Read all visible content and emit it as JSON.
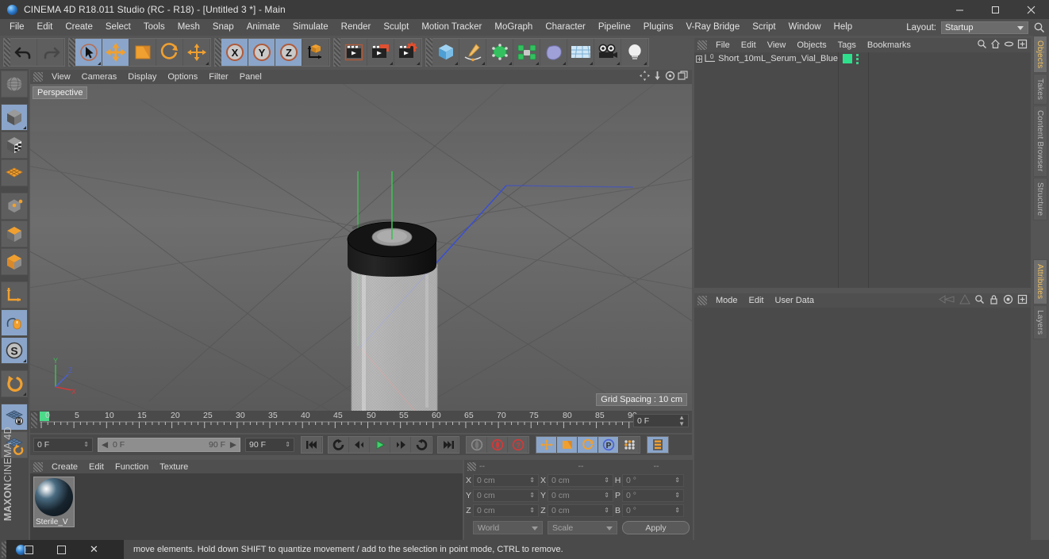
{
  "titlebar": {
    "title": "CINEMA 4D R18.011 Studio (RC - R18) - [Untitled 3 *] - Main",
    "minimize": "minimize-icon",
    "maximize": "maximize-icon",
    "close": "close-icon"
  },
  "menubar": {
    "items": [
      {
        "label": "File"
      },
      {
        "label": "Edit"
      },
      {
        "label": "Create"
      },
      {
        "label": "Select"
      },
      {
        "label": "Tools"
      },
      {
        "label": "Mesh"
      },
      {
        "label": "Snap"
      },
      {
        "label": "Animate"
      },
      {
        "label": "Simulate"
      },
      {
        "label": "Render"
      },
      {
        "label": "Sculpt"
      },
      {
        "label": "Motion Tracker"
      },
      {
        "label": "MoGraph"
      },
      {
        "label": "Character"
      },
      {
        "label": "Pipeline"
      },
      {
        "label": "Plugins"
      },
      {
        "label": "V-Ray Bridge"
      },
      {
        "label": "Script"
      },
      {
        "label": "Window"
      },
      {
        "label": "Help"
      }
    ],
    "layout_label": "Layout:",
    "layout_value": "Startup"
  },
  "toolbar": {
    "groups": [
      {
        "buttons": [
          {
            "name": "undo-button",
            "active": false
          },
          {
            "name": "redo-button",
            "active": false
          }
        ]
      },
      {
        "buttons": [
          {
            "name": "live-selection-tool",
            "active": true
          },
          {
            "name": "move-tool",
            "active": true
          },
          {
            "name": "scale-tool",
            "active": false
          },
          {
            "name": "rotate-tool",
            "active": false
          },
          {
            "name": "move-secondary-tool",
            "active": false
          }
        ]
      },
      {
        "buttons": [
          {
            "name": "x-axis-lock",
            "active": true
          },
          {
            "name": "y-axis-lock",
            "active": true
          },
          {
            "name": "z-axis-lock",
            "active": true
          },
          {
            "name": "world-object-coordinate-toggle",
            "active": false
          }
        ]
      },
      {
        "buttons": [
          {
            "name": "render-view-button",
            "active": false
          },
          {
            "name": "render-region-button",
            "active": false
          },
          {
            "name": "render-settings-button",
            "active": false
          }
        ]
      },
      {
        "buttons": [
          {
            "name": "add-cube-object",
            "active": false
          },
          {
            "name": "add-spline-object",
            "active": false
          },
          {
            "name": "add-generator-object",
            "active": false
          },
          {
            "name": "add-mograph-object",
            "active": false
          },
          {
            "name": "add-deformer-object",
            "active": false
          },
          {
            "name": "add-scene-object",
            "active": false
          },
          {
            "name": "add-camera-object",
            "active": false
          },
          {
            "name": "add-light-object",
            "active": false
          }
        ]
      }
    ]
  },
  "left_toolbar": {
    "buttons": [
      {
        "name": "make-editable-button",
        "active": false
      },
      {
        "name": "model-mode-button",
        "active": true
      },
      {
        "name": "texture-mode-button",
        "active": false
      },
      {
        "name": "polygon-mode-button",
        "active": false
      },
      {
        "name": "point-mode-button",
        "active": false
      },
      {
        "name": "edge-mode-button",
        "active": false
      },
      {
        "name": "face-mode-button",
        "active": false
      },
      {
        "name": "axis-mode-button",
        "active": false
      },
      {
        "name": "enable-axis-modification",
        "active": true
      },
      {
        "name": "soft-selection-button",
        "active": true
      },
      {
        "name": "undo-view-button",
        "active": false
      },
      {
        "name": "lock-workplane-button",
        "active": true
      },
      {
        "name": "workplane-toggle-button",
        "active": false
      }
    ],
    "brand_maxon": "MAXON",
    "brand_product": "CINEMA 4D"
  },
  "viewport": {
    "menus": [
      "View",
      "Cameras",
      "Display",
      "Options",
      "Filter",
      "Panel"
    ],
    "camera_tag": "Perspective",
    "grid_spacing": "Grid Spacing : 10 cm",
    "axis_labels": {
      "x": "X",
      "y": "Y",
      "z": "Z"
    },
    "corner_icons": [
      "pan-view-icon",
      "dolly-view-icon",
      "rotate-view-icon",
      "maximize-view-icon"
    ]
  },
  "timeline": {
    "ticks": [
      "0",
      "5",
      "10",
      "15",
      "20",
      "25",
      "30",
      "35",
      "40",
      "45",
      "50",
      "55",
      "60",
      "65",
      "70",
      "75",
      "80",
      "85",
      "90"
    ],
    "current_frame_field": "0 F"
  },
  "transport": {
    "start_frame": "0 F",
    "range_start": "0 F",
    "range_end": "90 F",
    "end_frame": "90 F",
    "buttons": [
      {
        "name": "goto-start-button",
        "active": false
      },
      {
        "name": "play-forwards-loop-button",
        "active": false
      },
      {
        "name": "step-back-button",
        "active": false
      },
      {
        "name": "play-button",
        "active": false
      },
      {
        "name": "step-forward-button",
        "active": false
      },
      {
        "name": "loop-button",
        "active": false
      },
      {
        "name": "goto-end-button",
        "active": false
      },
      {
        "name": "record-active-objects-button",
        "active": false
      },
      {
        "name": "autokeying-button",
        "active": false
      },
      {
        "name": "keyframe-selection-button",
        "active": false
      },
      {
        "name": "position-key-button",
        "active": true
      },
      {
        "name": "scale-key-button",
        "active": true
      },
      {
        "name": "rotation-key-button",
        "active": true
      },
      {
        "name": "parameter-key-button",
        "active": true
      },
      {
        "name": "point-level-animation-button",
        "active": false
      },
      {
        "name": "timeline-panel-button",
        "active": true
      }
    ]
  },
  "material_manager": {
    "menus": [
      "Create",
      "Edit",
      "Function",
      "Texture"
    ],
    "materials": [
      {
        "name": "Sterile_V"
      }
    ]
  },
  "coordinates": {
    "headers": [
      "--",
      "--",
      "--"
    ],
    "rows": [
      {
        "pos_label": "X",
        "pos_value": "0 cm",
        "size_label": "X",
        "size_value": "0 cm",
        "rot_label": "H",
        "rot_value": "0 °"
      },
      {
        "pos_label": "Y",
        "pos_value": "0 cm",
        "size_label": "Y",
        "size_value": "0 cm",
        "rot_label": "P",
        "rot_value": "0 °"
      },
      {
        "pos_label": "Z",
        "pos_value": "0 cm",
        "size_label": "Z",
        "size_value": "0 cm",
        "rot_label": "B",
        "rot_value": "0 °"
      }
    ],
    "space_select": "World",
    "mode_select": "Scale",
    "apply_button": "Apply"
  },
  "object_manager": {
    "menus": [
      "File",
      "Edit",
      "View",
      "Objects",
      "Tags",
      "Bookmarks"
    ],
    "icons": [
      "search-icon",
      "home-icon",
      "link-icon",
      "new-layer-icon"
    ],
    "objects": [
      {
        "name": "Short_10mL_Serum_Vial_Blue",
        "tag_color": "#2ee08c"
      }
    ]
  },
  "attributes": {
    "menus": [
      "Mode",
      "Edit",
      "User Data"
    ],
    "icons": [
      "back-arrow-icon",
      "forward-arrow-icon",
      "search-icon",
      "lock-icon",
      "target-icon",
      "new-tab-icon"
    ]
  },
  "vertical_tabs": {
    "top": [
      {
        "label": "Objects",
        "active": true
      },
      {
        "label": "Takes",
        "active": false
      },
      {
        "label": "Content Browser",
        "active": false
      },
      {
        "label": "Structure",
        "active": false
      }
    ],
    "bottom": [
      {
        "label": "Attributes",
        "active": true
      },
      {
        "label": "Layers",
        "active": false
      }
    ]
  },
  "statusbar": {
    "message": "move elements. Hold down SHIFT to quantize movement / add to the selection in point mode, CTRL to remove."
  },
  "taskbar": {
    "app_icon": "cinema4d-icon",
    "window_icon": "window-icon",
    "restore_icon": "restore-icon",
    "close_icon": "close-icon"
  }
}
